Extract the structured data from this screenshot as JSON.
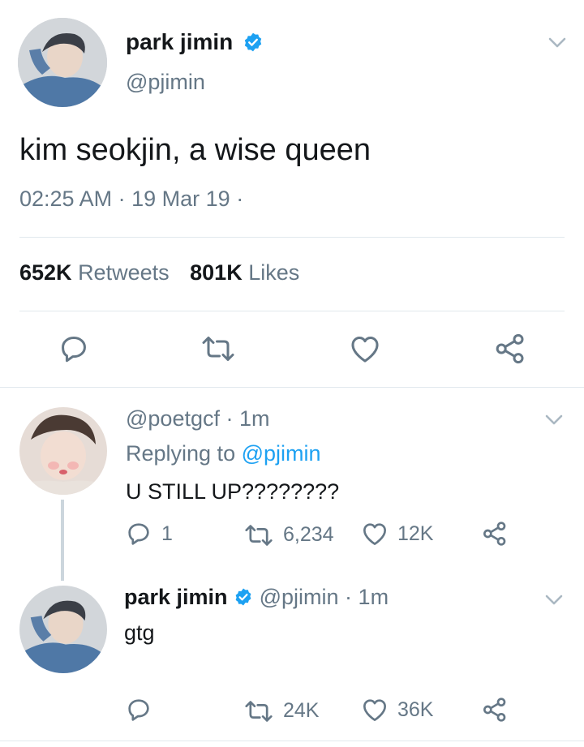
{
  "main_tweet": {
    "display_name": "park jimin",
    "handle": "@pjimin",
    "text": "kim seokjin, a wise queen",
    "time": "02:25 AM",
    "date": "19 Mar 19",
    "sep": "·",
    "retweets_count": "652K",
    "retweets_label": "Retweets",
    "likes_count": "801K",
    "likes_label": "Likes"
  },
  "reply1": {
    "handle": "@poetgcf",
    "time": "1m",
    "sep": "·",
    "replying_prefix": "Replying to",
    "replying_handle": "@pjimin",
    "text": "U STILL UP????????",
    "reply_count": "1",
    "retweet_count": "6,234",
    "like_count": "12K"
  },
  "reply2": {
    "display_name": "park jimin",
    "handle": "@pjimin",
    "time": "1m",
    "sep": "·",
    "text": "gtg",
    "retweet_count": "24K",
    "like_count": "36K"
  },
  "icons": {
    "reply": "reply-icon",
    "retweet": "retweet-icon",
    "like": "heart-icon",
    "share": "share-icon",
    "verified": "verified-badge-icon",
    "menu": "chevron-down-icon"
  },
  "colors": {
    "accent": "#1da1f2",
    "secondary_text": "#657786",
    "divider": "#e1e8ed"
  }
}
